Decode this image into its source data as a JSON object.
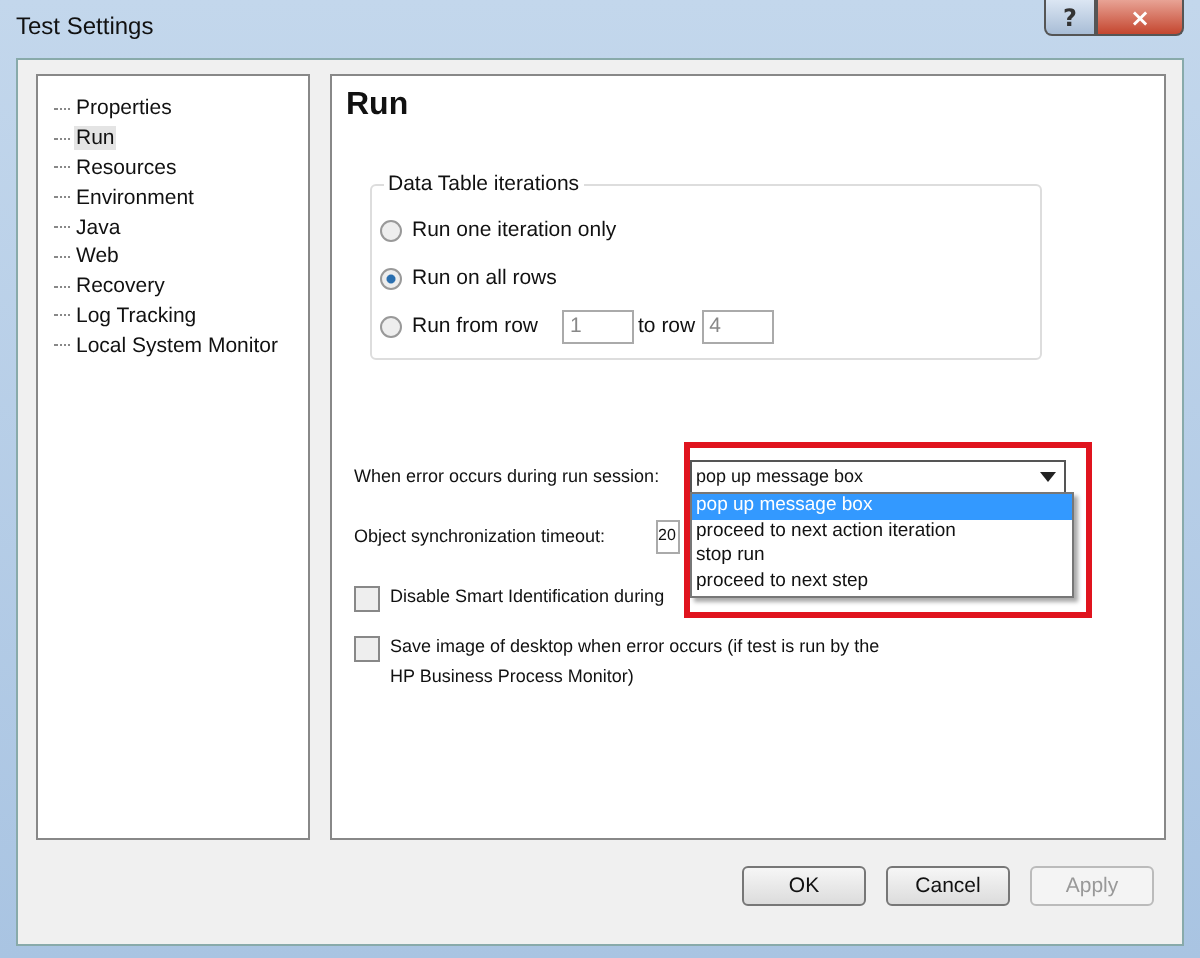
{
  "window": {
    "title": "Test Settings",
    "help_button": "?",
    "close_button": "×"
  },
  "tree": {
    "items": [
      {
        "label": "Properties",
        "selected": false
      },
      {
        "label": "Run",
        "selected": true
      },
      {
        "label": "Resources",
        "selected": false
      },
      {
        "label": "Environment",
        "selected": false
      },
      {
        "label": "Java",
        "selected": false
      },
      {
        "label": "Web",
        "selected": false
      },
      {
        "label": "Recovery",
        "selected": false
      },
      {
        "label": "Log Tracking",
        "selected": false
      },
      {
        "label": "Local System Monitor",
        "selected": false
      }
    ]
  },
  "page": {
    "heading": "Run",
    "iterations": {
      "title": "Data Table iterations",
      "options": [
        {
          "label": "Run one iteration only",
          "selected": false
        },
        {
          "label": "Run on all rows",
          "selected": true
        },
        {
          "label": "Run from row",
          "selected": false
        }
      ],
      "from_row": "1",
      "to_label": "to row",
      "to_row": "4"
    },
    "error": {
      "label": "When error occurs during run session:",
      "value": "pop up message box",
      "options": [
        {
          "label": "pop up message box",
          "selected": true
        },
        {
          "label": "proceed to next action iteration",
          "selected": false
        },
        {
          "label": "stop run",
          "selected": false
        },
        {
          "label": "proceed to next step",
          "selected": false
        }
      ]
    },
    "timeout": {
      "label": "Object synchronization timeout:",
      "value": "20"
    },
    "checks": [
      {
        "label": "Disable Smart Identification during",
        "checked": false
      },
      {
        "label": "Save image of desktop when error occurs (if test is run by the HP Business Process Monitor)",
        "checked": false
      }
    ]
  },
  "buttons": [
    {
      "label": "OK",
      "disabled": false
    },
    {
      "label": "Cancel",
      "disabled": false
    },
    {
      "label": "Apply",
      "disabled": true
    }
  ]
}
